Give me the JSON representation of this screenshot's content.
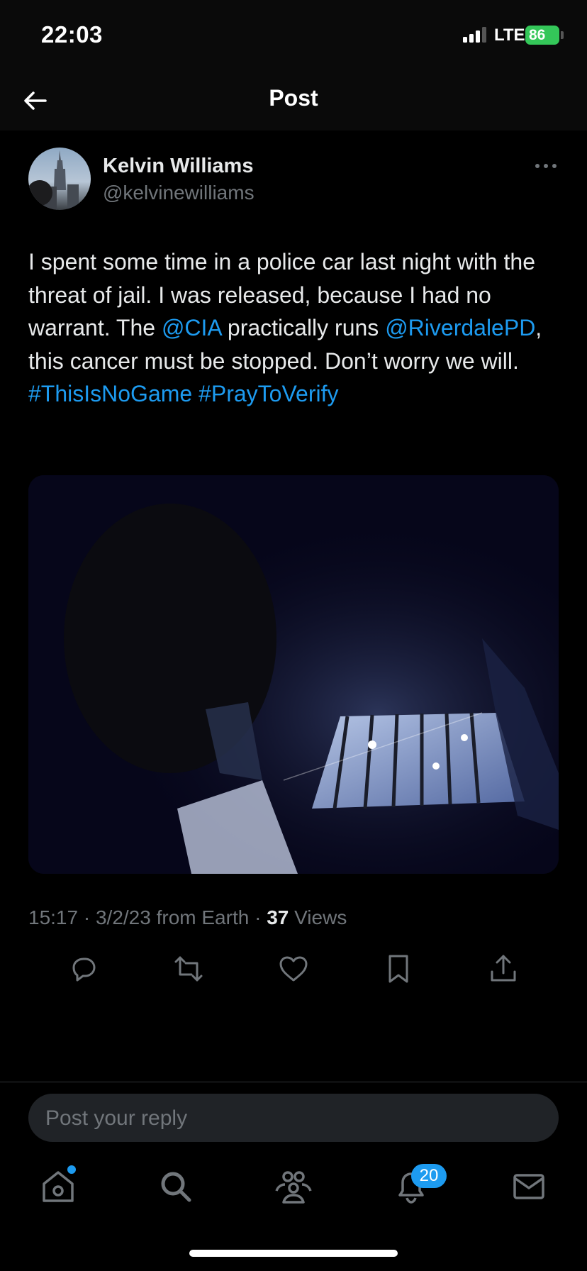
{
  "status_bar": {
    "time": "22:03",
    "network": "LTE",
    "battery": "86"
  },
  "header": {
    "title": "Post"
  },
  "author": {
    "name": "Kelvin Williams",
    "handle": "@kelvinewilliams"
  },
  "tweet": {
    "segments": [
      {
        "text": "I spent some time in a police car last night with the threat of jail. I was released, because I had no warrant. The ",
        "link": false
      },
      {
        "text": "@CIA",
        "link": true
      },
      {
        "text": " practically runs ",
        "link": false
      },
      {
        "text": "@RiverdalePD",
        "link": true
      },
      {
        "text": ", this cancer must be stopped. Don’t worry we will. ",
        "link": false
      },
      {
        "text": "#ThisIsNoGame",
        "link": true
      },
      {
        "text": " ",
        "link": false
      },
      {
        "text": "#PrayToVerify",
        "link": true
      }
    ]
  },
  "meta": {
    "time": "15:17",
    "date": "3/2/23 from Earth",
    "views_count": "37",
    "views_label": "Views"
  },
  "reply": {
    "placeholder": "Post your reply"
  },
  "tabbar": {
    "notifications_count": "20"
  },
  "icons": {
    "back": "back-arrow-icon",
    "more": "more-icon",
    "reply": "reply-icon",
    "repost": "repost-icon",
    "like": "like-icon",
    "bookmark": "bookmark-icon",
    "share": "share-icon",
    "home": "home-icon",
    "search": "search-icon",
    "communities": "communities-icon",
    "notifications": "notifications-icon",
    "messages": "messages-icon"
  },
  "colors": {
    "accent": "#1d9bf0",
    "background": "#000000",
    "secondary_text": "#71767b",
    "battery": "#34c759"
  }
}
